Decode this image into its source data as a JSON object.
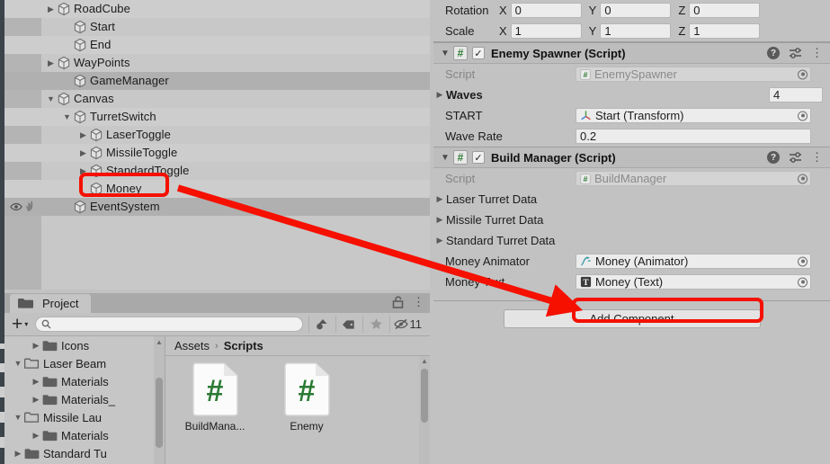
{
  "hierarchy": {
    "name": "Hierarchy",
    "rows": [
      {
        "label": "RoadCube",
        "indent": 1,
        "triangle": "collapsed",
        "selected": false,
        "banded": true,
        "gutter": []
      },
      {
        "label": "Start",
        "indent": 2,
        "triangle": "none",
        "selected": false,
        "banded": false,
        "gutter": []
      },
      {
        "label": "End",
        "indent": 2,
        "triangle": "none",
        "selected": false,
        "banded": true,
        "gutter": []
      },
      {
        "label": "WayPoints",
        "indent": 1,
        "triangle": "collapsed",
        "selected": false,
        "banded": false,
        "gutter": []
      },
      {
        "label": "GameManager",
        "indent": 2,
        "triangle": "none",
        "selected": true,
        "banded": false,
        "gutter": []
      },
      {
        "label": "Canvas",
        "indent": 1,
        "triangle": "expanded",
        "selected": false,
        "banded": false,
        "gutter": []
      },
      {
        "label": "TurretSwitch",
        "indent": 2,
        "triangle": "expanded",
        "selected": false,
        "banded": true,
        "gutter": []
      },
      {
        "label": "LaserToggle",
        "indent": 3,
        "triangle": "collapsed",
        "selected": false,
        "banded": false,
        "gutter": []
      },
      {
        "label": "MissileToggle",
        "indent": 3,
        "triangle": "collapsed",
        "selected": false,
        "banded": true,
        "gutter": []
      },
      {
        "label": "StandardToggle",
        "indent": 3,
        "triangle": "collapsed",
        "selected": false,
        "banded": false,
        "gutter": []
      },
      {
        "label": "Money",
        "indent": 3,
        "triangle": "none",
        "selected": false,
        "banded": true,
        "gutter": []
      },
      {
        "label": "EventSystem",
        "indent": 2,
        "triangle": "none",
        "selected": true,
        "banded": false,
        "gutter": [
          "eye-icon",
          "hand-pointer-icon"
        ]
      }
    ]
  },
  "project": {
    "tab_label": "Project",
    "tab_icon": "folder-icon",
    "lock_icon": "lock-open-icon",
    "menu_icon": "kebab-menu-icon",
    "toolbar": {
      "create_label": "+",
      "create_caret": "▾",
      "search_placeholder": "",
      "search_value": "",
      "search_icon": "search-icon",
      "filter_type_icon": "filter-by-type-icon",
      "filter_label_icon": "label-tag-icon",
      "favorite_icon": "star-icon",
      "hidden_icon": "eye-slash-icon",
      "hidden_count": "11"
    },
    "tree": [
      {
        "label": "Icons",
        "indent": 2,
        "triangle": "none",
        "folder": "folder-closed-icon"
      },
      {
        "label": "Laser Beam",
        "indent": 1,
        "triangle": "expanded",
        "folder": "folder-open-icon"
      },
      {
        "label": "Materials",
        "indent": 2,
        "triangle": "none",
        "folder": "folder-closed-icon"
      },
      {
        "label": "Materials_",
        "indent": 2,
        "triangle": "none",
        "folder": "folder-closed-icon"
      },
      {
        "label": "Missile Lau",
        "indent": 1,
        "triangle": "expanded",
        "folder": "folder-open-icon"
      },
      {
        "label": "Materials",
        "indent": 2,
        "triangle": "none",
        "folder": "folder-closed-icon"
      },
      {
        "label": "Standard Tu",
        "indent": 1,
        "triangle": "collapsed",
        "folder": "folder-closed-icon"
      }
    ],
    "breadcrumb": {
      "root": "Assets",
      "separator": "›",
      "current": "Scripts"
    },
    "assets": [
      {
        "name": "BuildMana...",
        "icon": "csharp-script-icon"
      },
      {
        "name": "Enemy",
        "icon": "csharp-script-icon"
      }
    ]
  },
  "inspector": {
    "transform": {
      "rows": [
        {
          "label": "Rotation",
          "axes": [
            "X",
            "Y",
            "Z"
          ],
          "values": [
            "0",
            "0",
            "0"
          ]
        },
        {
          "label": "Scale",
          "axes": [
            "X",
            "Y",
            "Z"
          ],
          "values": [
            "1",
            "1",
            "1"
          ]
        }
      ]
    },
    "components": [
      {
        "title": "Enemy Spawner (Script)",
        "script_badge": "#",
        "enabled": true,
        "expanded": true,
        "help_icon": "help-icon",
        "preset_icon": "preset-sliders-icon",
        "menu_icon": "kebab-menu-icon",
        "fields": [
          {
            "label": "Script",
            "kind": "object",
            "value": "EnemySpawner",
            "value_icon": "csharp-script-icon",
            "dim": true,
            "triangle": "none",
            "picker": true
          },
          {
            "label": "Waves",
            "kind": "count",
            "value": "4",
            "value_icon": "",
            "dim": false,
            "triangle": "collapsed",
            "picker": false,
            "bold": true
          },
          {
            "label": "START",
            "kind": "object",
            "value": "Start (Transform)",
            "value_icon": "transform-axis-icon",
            "dim": false,
            "triangle": "none",
            "picker": true
          },
          {
            "label": "Wave Rate",
            "kind": "number",
            "value": "0.2",
            "value_icon": "",
            "dim": false,
            "triangle": "none",
            "picker": false
          }
        ]
      },
      {
        "title": "Build Manager (Script)",
        "script_badge": "#",
        "enabled": true,
        "expanded": true,
        "help_icon": "help-icon",
        "preset_icon": "preset-sliders-icon",
        "menu_icon": "kebab-menu-icon",
        "fields": [
          {
            "label": "Script",
            "kind": "object",
            "value": "BuildManager",
            "value_icon": "csharp-script-icon",
            "dim": true,
            "triangle": "none",
            "picker": true
          },
          {
            "label": "Laser Turret Data",
            "kind": "foldout",
            "value": "",
            "value_icon": "",
            "dim": false,
            "triangle": "collapsed",
            "picker": false
          },
          {
            "label": "Missile Turret Data",
            "kind": "foldout",
            "value": "",
            "value_icon": "",
            "dim": false,
            "triangle": "collapsed",
            "picker": false
          },
          {
            "label": "Standard Turret Data",
            "kind": "foldout",
            "value": "",
            "value_icon": "",
            "dim": false,
            "triangle": "collapsed",
            "picker": false
          },
          {
            "label": "Money Animator",
            "kind": "object",
            "value": "Money (Animator)",
            "value_icon": "animator-icon",
            "dim": false,
            "triangle": "none",
            "picker": true
          },
          {
            "label": "Money Text",
            "kind": "object",
            "value": "Money (Text)",
            "value_icon": "text-component-icon",
            "dim": false,
            "triangle": "none",
            "picker": true
          }
        ]
      }
    ],
    "add_component_label": "Add Component"
  },
  "annotations": {
    "accent_color": "#f51000",
    "highlight_money_hierarchy": "Money",
    "highlight_money_animator": "Money (Animator)",
    "arrow": "red-arrow-from-money-to-money-animator"
  }
}
